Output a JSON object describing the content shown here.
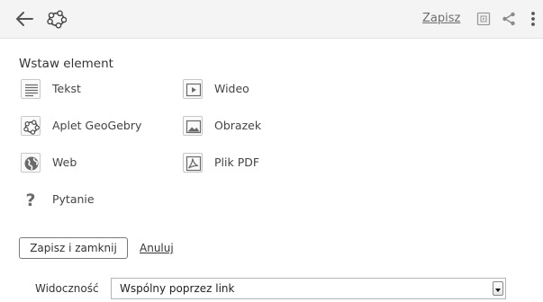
{
  "header": {
    "back_icon": "arrow-left-icon",
    "logo_icon": "geogebra-logo-icon",
    "save_label": "Zapisz",
    "preview_icon": "preview-icon",
    "share_icon": "share-icon",
    "more_icon": "more-vertical-icon"
  },
  "insert": {
    "title": "Wstaw element",
    "items": [
      {
        "label": "Tekst",
        "icon": "text-icon"
      },
      {
        "label": "Wideo",
        "icon": "video-icon"
      },
      {
        "label": "Aplet GeoGebry",
        "icon": "geogebra-applet-icon"
      },
      {
        "label": "Obrazek",
        "icon": "image-icon"
      },
      {
        "label": "Web",
        "icon": "web-icon"
      },
      {
        "label": "Plik PDF",
        "icon": "pdf-icon"
      },
      {
        "label": "Pytanie",
        "icon": "question-icon"
      }
    ]
  },
  "actions": {
    "save_close_label": "Zapisz i zamknij",
    "cancel_label": "Anuluj"
  },
  "visibility": {
    "label": "Widoczność",
    "selected": "Wspólny poprzez link"
  },
  "colors": {
    "header_bg": "#f4f4f4",
    "icon_gray": "#6a6a6a"
  }
}
